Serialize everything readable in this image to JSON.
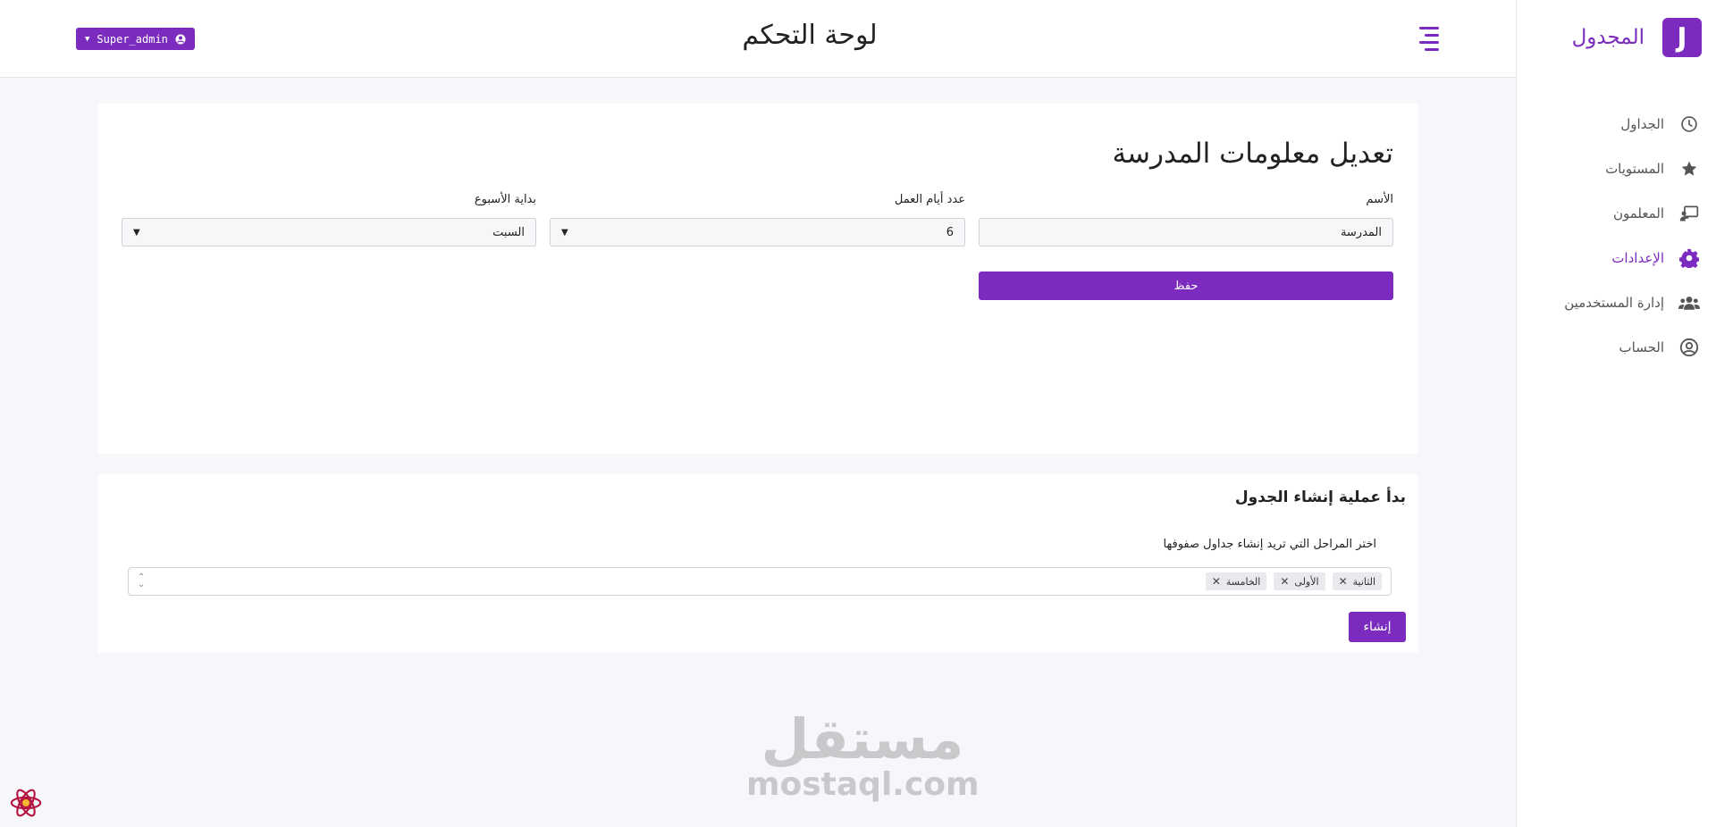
{
  "brand": {
    "logo_letter": "J",
    "name": "المجدول",
    "accent_color": "#7b2cbf"
  },
  "header": {
    "title": "لوحة التحكم",
    "user_label": "Super_admin",
    "user_icon": "user-circle-icon"
  },
  "sidebar": {
    "items": [
      {
        "label": "الجداول",
        "icon": "clock-icon",
        "active": false
      },
      {
        "label": "المستويات",
        "icon": "star-icon",
        "active": false
      },
      {
        "label": "المعلمون",
        "icon": "chalkboard-teacher-icon",
        "active": false
      },
      {
        "label": "الإعدادات",
        "icon": "gear-icon",
        "active": true
      },
      {
        "label": "إدارة المستخدمين",
        "icon": "users-icon",
        "active": false
      },
      {
        "label": "الحساب",
        "icon": "user-circle-icon",
        "active": false
      }
    ]
  },
  "school_form": {
    "title": "تعديل معلومات المدرسة",
    "name_label": "الأسم",
    "name_value": "المدرسة",
    "workdays_label": "عدد أيام العمل",
    "workdays_value": "6",
    "week_start_label": "بداية الأسبوع",
    "week_start_value": "السبت",
    "save_label": "حفظ"
  },
  "schedule_section": {
    "title": "بدأ عملية إنشاء الجدول",
    "select_label": "اختر المراحل التي تريد إنشاء جداول صفوفها",
    "selected_stages": [
      "الثانية",
      "الأولى",
      "الخامسة"
    ],
    "create_label": "إنشاء"
  },
  "watermark": {
    "arabic": "مستقل",
    "latin": "mostaql.com"
  }
}
